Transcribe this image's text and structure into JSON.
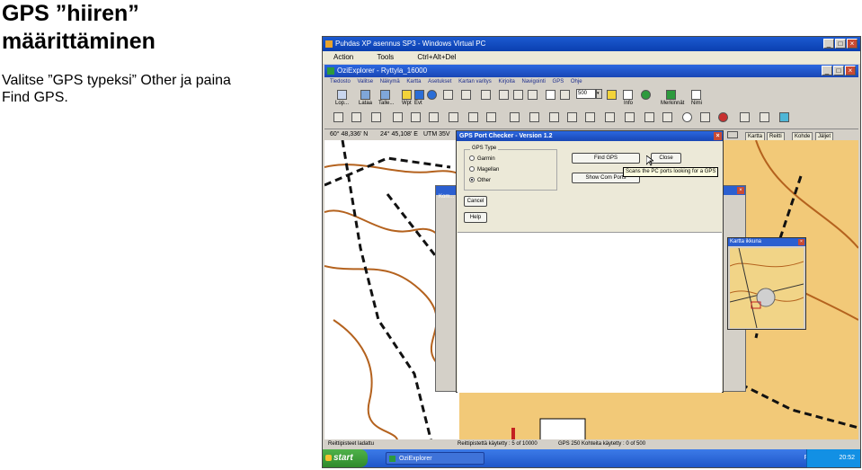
{
  "slide": {
    "title_line1": "GPS ”hiiren”",
    "title_line2": "määrittäminen",
    "body_line1": "Valitse ”GPS typeksi” Other ja paina",
    "body_line2": "Find GPS."
  },
  "vpc": {
    "title": "Puhdas XP asennus SP3 - Windows Virtual PC",
    "menu": [
      "Action",
      "Tools",
      "Ctrl+Alt+Del"
    ]
  },
  "ozi": {
    "title": "OziExplorer - Ryttyla_16000",
    "menu": [
      "Tiedosto",
      "Valitse",
      "Näkymä",
      "Kartta",
      "Asetukset",
      "Kartan varitys",
      "Kirjoita",
      "Navigointi",
      "GPS",
      "Ohje"
    ],
    "toolbar_labels": [
      "Lop...",
      "Lataa",
      "Talle...",
      "Wpt",
      "Evt",
      "Info",
      "Nimi",
      "Merkinnät"
    ],
    "zoom_value": "500",
    "coords": {
      "lat": "60° 48,336' N",
      "lon": "24° 45,108' E",
      "utm": "UTM 35V"
    },
    "map_buttons": [
      "Kartta",
      "Reitti",
      "Kohde",
      "Jäljet"
    ],
    "status": {
      "left": "Reittipisteet ladattu",
      "mid": "Reittipistettä käytetty : 5 of 10000",
      "right": "GPS 250 Kohteita käytetty : 0 of 500"
    }
  },
  "gps_dialog": {
    "title": "GPS Port Checker - Version 1.2",
    "group_label": "GPS Type",
    "options": [
      "Garmin",
      "Magellan",
      "Other"
    ],
    "selected": "Other",
    "find_label": "Find GPS",
    "close_label": "Close",
    "show_ports_label": "Show Com Ports",
    "cancel_label": "Cancel",
    "help_label": "Help",
    "tooltip": "Scans the PC ports looking for a GPS"
  },
  "bg_dialog": {
    "title": "Kom..."
  },
  "minimap": {
    "title": "Kartta ikkuna"
  },
  "taskbar": {
    "start_label": "start",
    "item": "OziExplorer",
    "tray_lang": "FI",
    "clock": "20:52"
  }
}
